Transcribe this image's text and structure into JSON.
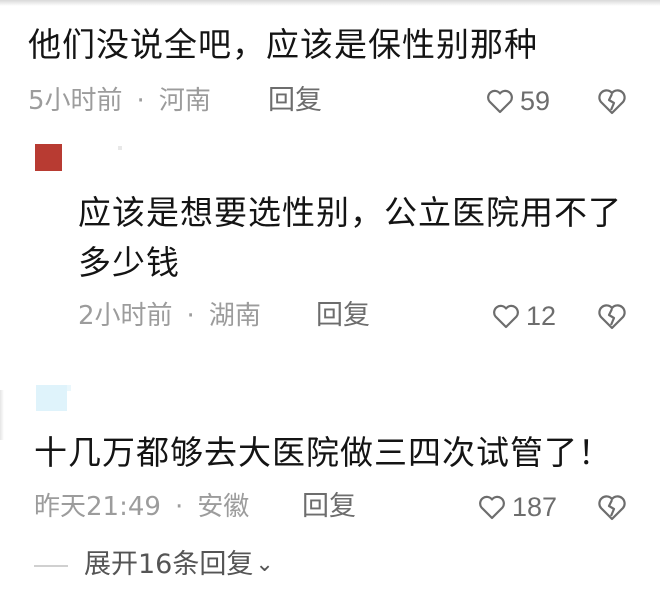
{
  "comment1": {
    "text": "他们没说全吧，应该是保性别那种",
    "time": "5小时前",
    "location": "河南",
    "reply_label": "回复",
    "likes": "59"
  },
  "reply1": {
    "text_line1": "应该是想要选性别，公立医院用不了",
    "text_line2": "多少钱",
    "time": "2小时前",
    "location": "湖南",
    "reply_label": "回复",
    "likes": "12"
  },
  "comment2": {
    "text": "十几万都够去大医院做三四次试管了！",
    "time": "昨天21:49",
    "location": "安徽",
    "reply_label": "回复",
    "likes": "187"
  },
  "expand": {
    "label": "展开16条回复"
  },
  "separator": "·",
  "colors": {
    "text": "#141414",
    "meta": "#9c9c9c",
    "action": "#6d6d6d",
    "avatar_red": "#b83b32",
    "avatar_blue": "#dff3fb"
  },
  "icons": [
    "heart-icon",
    "broken-heart-icon",
    "chevron-down-icon"
  ]
}
